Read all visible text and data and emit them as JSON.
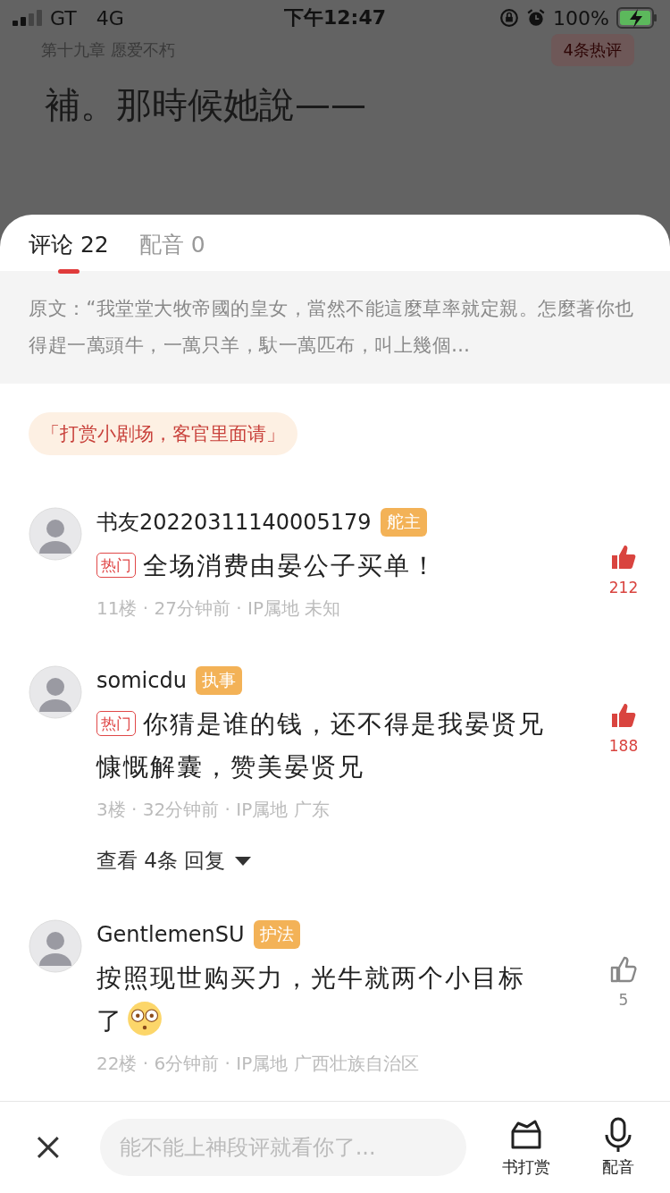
{
  "status_bar": {
    "carrier": "GT",
    "network": "4G",
    "time": "下午12:47",
    "battery": "100%",
    "charging": true
  },
  "reader": {
    "chapter": "第十九章 愿爱不朽",
    "hot_badge": "4条热评",
    "text": "補。那時候她說——"
  },
  "tabs": [
    {
      "label": "评论",
      "count": "22",
      "selected": true
    },
    {
      "label": "配音",
      "count": "0",
      "selected": false
    }
  ],
  "quote": "原文：“我堂堂大牧帝國的皇女，當然不能這麼草率就定親。怎麼著你也得趕一萬頭牛，一萬只羊，馱一萬匹布，叫上幾個…",
  "promo": "「打赏小剧场，客官里面请」",
  "comments": [
    {
      "user": "书友20220311140005179",
      "badge": "舵主",
      "hot": true,
      "hot_label": "热门",
      "text": "全场消费由晏公子买单！",
      "emoji": false,
      "meta": "11楼 · 27分钟前 · IP属地 未知",
      "likes": "212",
      "liked": true
    },
    {
      "user": "somicdu",
      "badge": "执事",
      "hot": true,
      "hot_label": "热门",
      "text": "你猜是谁的钱，还不得是我晏贤兄慷慨解囊，赞美晏贤兄",
      "emoji": false,
      "meta": "3楼 · 32分钟前 · IP属地 广东",
      "likes": "188",
      "liked": true,
      "replies": "查看 4条 回复"
    },
    {
      "user": "GentlemenSU",
      "badge": "护法",
      "hot": false,
      "text": "按照现世购买力，光牛就两个小目标了",
      "emoji": true,
      "meta": "22楼 · 6分钟前 · IP属地 广西壮族自治区",
      "likes": "5",
      "liked": false
    }
  ],
  "composer": {
    "placeholder": "能不能上神段评就看你了..."
  },
  "actions": [
    {
      "kind": "gift",
      "label": "书打赏"
    },
    {
      "kind": "voice",
      "label": "配音"
    }
  ]
}
